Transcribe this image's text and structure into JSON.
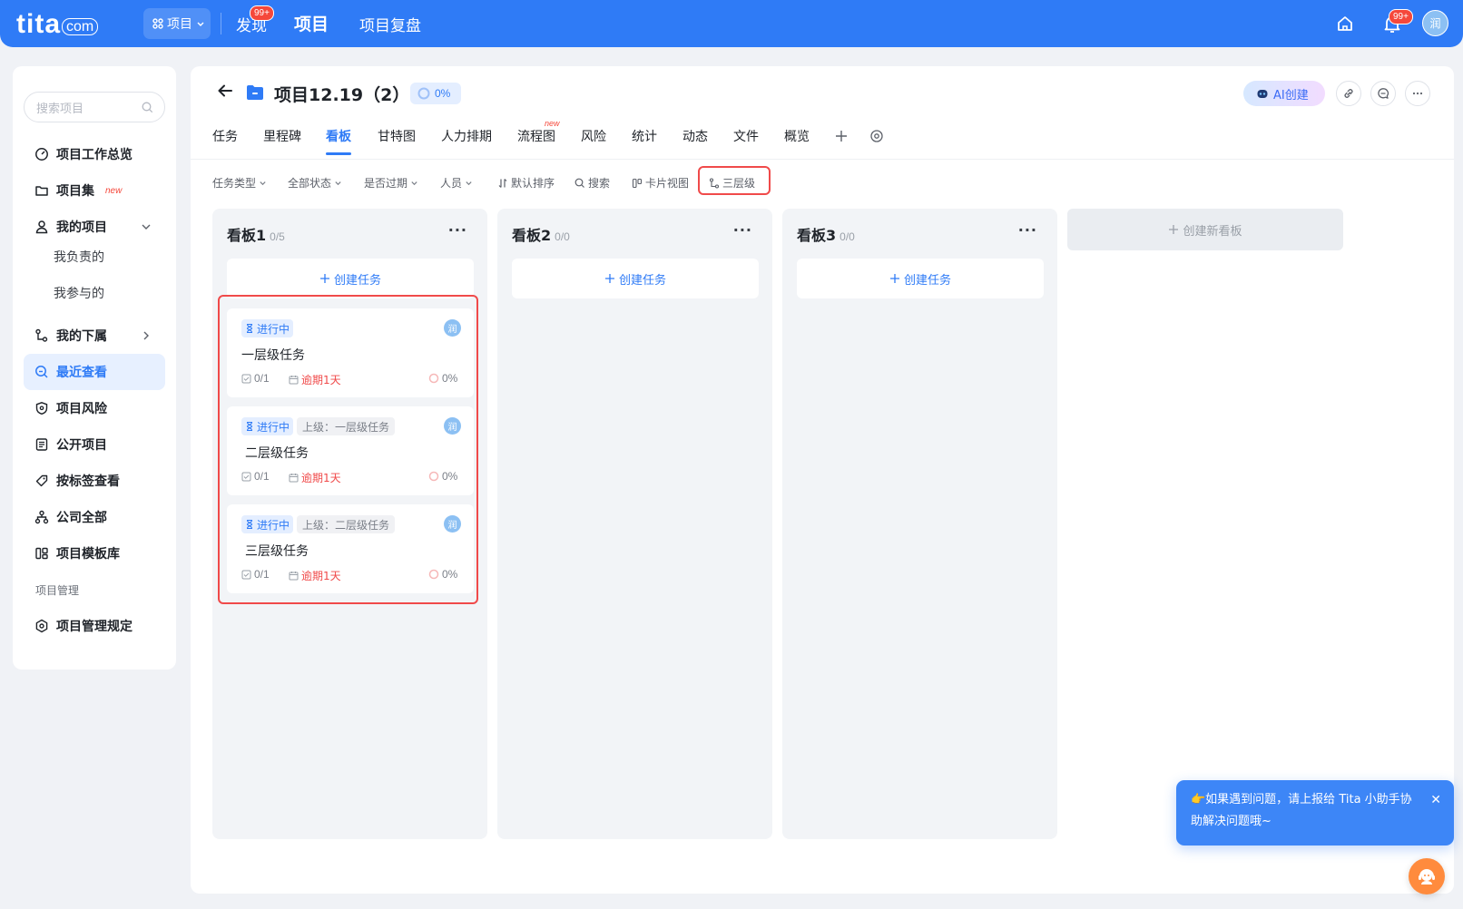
{
  "brand": {
    "logo": "tita",
    "logo_sub": "com"
  },
  "topnav": {
    "app_switch": "项目",
    "items": [
      "发现",
      "项目",
      "项目复盘"
    ],
    "discover_badge": "99+",
    "notification_badge": "99+",
    "user_initial": "润"
  },
  "sidebar": {
    "search_placeholder": "搜索项目",
    "items": {
      "overview": "项目工作总览",
      "collections": "项目集",
      "collections_tag": "new",
      "my_projects": "我的项目",
      "my_lead": "我负责的",
      "my_join": "我参与的",
      "subordinates": "我的下属",
      "recent": "最近查看",
      "risk": "项目风险",
      "public": "公开项目",
      "by_tag": "按标签查看",
      "company": "公司全部",
      "templates": "项目模板库",
      "section_manage": "项目管理",
      "rules": "项目管理规定"
    }
  },
  "project": {
    "title": "项目12.19（2）",
    "progress": "0%",
    "ai_button": "AI创建"
  },
  "tabs": [
    "任务",
    "里程碑",
    "看板",
    "甘特图",
    "人力排期",
    "流程图",
    "风险",
    "统计",
    "动态",
    "文件",
    "概览"
  ],
  "tab_new_tag": "new",
  "active_tab": "看板",
  "filters": {
    "task_type": "任务类型",
    "status": "全部状态",
    "overdue": "是否过期",
    "people": "人员",
    "sort": "默认排序",
    "search": "搜索",
    "view": "卡片视图",
    "levels": "三层级"
  },
  "boards": [
    {
      "title": "看板1",
      "count": "0/5",
      "create": "创建任务"
    },
    {
      "title": "看板2",
      "count": "0/0",
      "create": "创建任务"
    },
    {
      "title": "看板3",
      "count": "0/0",
      "create": "创建任务"
    }
  ],
  "new_board": "创建新看板",
  "cards": [
    {
      "status": "进行中",
      "parent": "",
      "title": "一层级任务",
      "checklist": "0/1",
      "due": "逾期1天",
      "progress": "0%",
      "assignee": "润"
    },
    {
      "status": "进行中",
      "parent": "上级：一层级任务",
      "title": "二层级任务",
      "checklist": "0/1",
      "due": "逾期1天",
      "progress": "0%",
      "assignee": "润"
    },
    {
      "status": "进行中",
      "parent": "上级：二层级任务",
      "title": "三层级任务",
      "checklist": "0/1",
      "due": "逾期1天",
      "progress": "0%",
      "assignee": "润"
    }
  ],
  "help": {
    "message": "👉如果遇到问题，请上报给 Tita 小助手协助解决问题哦~"
  },
  "colors": {
    "primary": "#2f7bf6",
    "danger": "#f04a4a",
    "background": "#f0f2f6"
  }
}
